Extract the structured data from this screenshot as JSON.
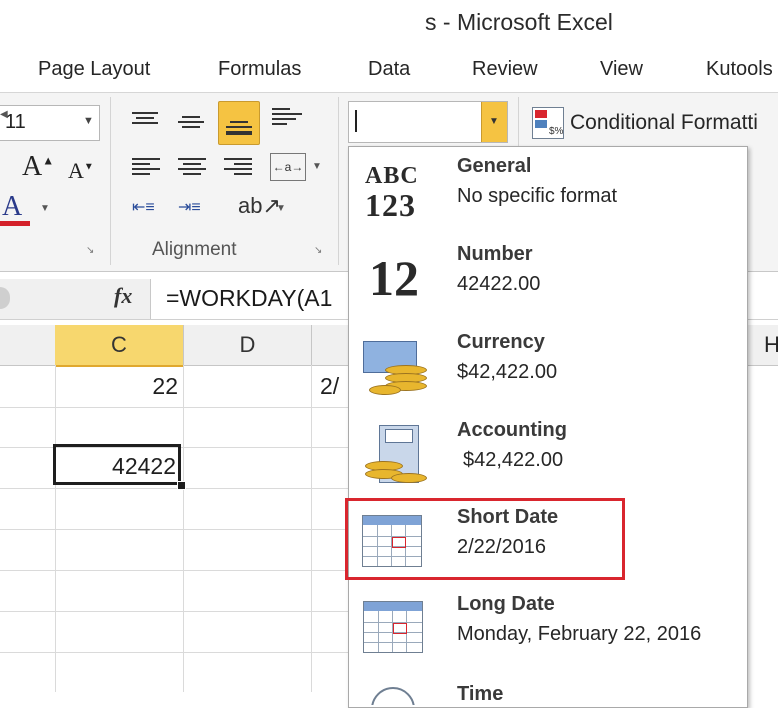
{
  "title": "s  -  Microsoft Excel",
  "tabs": [
    "Page Layout",
    "Formulas",
    "Data",
    "Review",
    "View",
    "Kutools"
  ],
  "ribbon": {
    "font_size": "11",
    "alignment_group_label": "Alignment",
    "number_format_value": "",
    "conditional_format_label": "Conditional Formatti"
  },
  "formula_bar": {
    "fx_label": "fx",
    "formula": "=WORKDAY(A1"
  },
  "grid": {
    "columns": [
      "C",
      "D",
      "",
      "H"
    ],
    "cells": {
      "c1": "22",
      "d1": "2/",
      "c3": "42422"
    }
  },
  "format_menu": {
    "items": [
      {
        "title": "General",
        "sub": "No specific format",
        "icon": "abc-123-icon"
      },
      {
        "title": "Number",
        "sub": "42422.00",
        "icon": "number-12-icon"
      },
      {
        "title": "Currency",
        "sub": "$42,422.00",
        "icon": "currency-icon"
      },
      {
        "title": "Accounting",
        "sub": "$42,422.00",
        "icon": "accounting-icon"
      },
      {
        "title": "Short Date",
        "sub": "2/22/2016",
        "icon": "calendar-icon"
      },
      {
        "title": "Long Date",
        "sub": "Monday, February 22, 2016",
        "icon": "calendar-icon"
      },
      {
        "title": "Time",
        "sub": "",
        "icon": "clock-icon"
      }
    ],
    "general_icon_text": {
      "top": "ABC",
      "bottom": "123"
    },
    "number_icon_text": "12",
    "highlight_color": "#d9262e"
  },
  "colors": {
    "accent_orange": "#f5c342",
    "font_color_underline": "#d4202a",
    "selected_header": "#f7d76e"
  }
}
